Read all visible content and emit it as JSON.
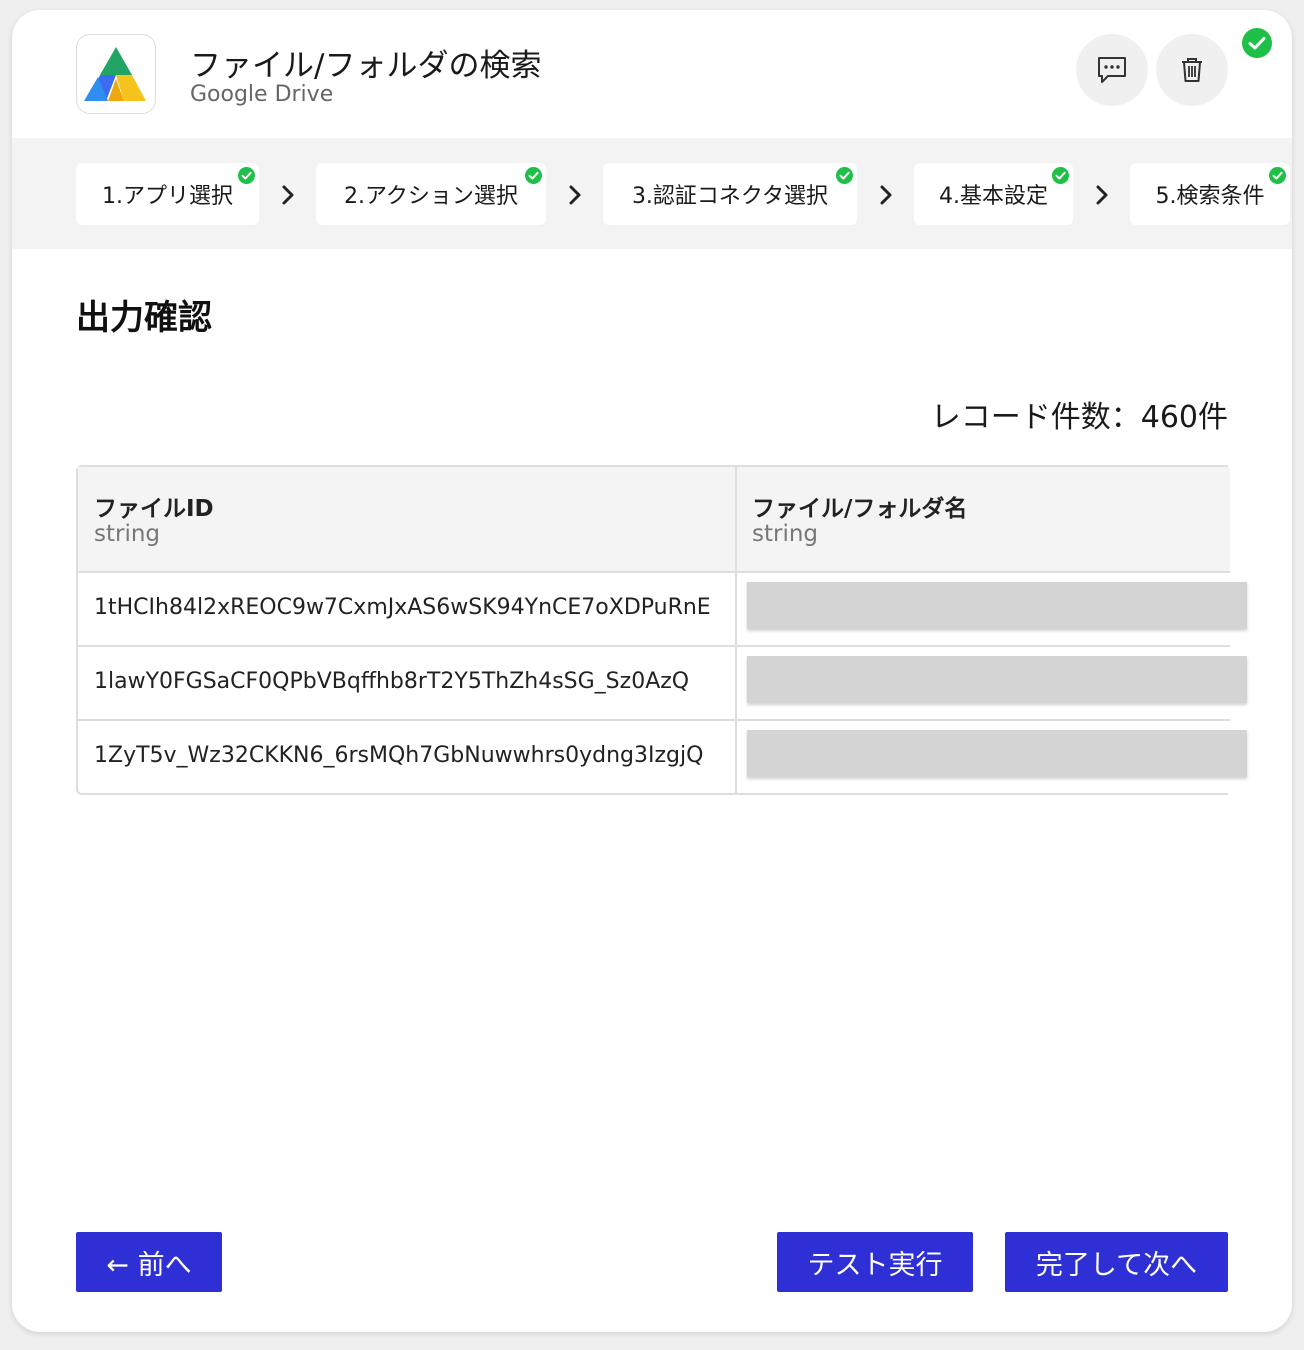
{
  "header": {
    "title": "ファイル/フォルダの検索",
    "subtitle": "Google Drive",
    "app_icon": "google-drive-logo",
    "comment_icon": "comment-icon",
    "delete_icon": "trash-icon",
    "status_icon": "check-circle-icon"
  },
  "steps": [
    {
      "label": "1.アプリ選択",
      "done": true
    },
    {
      "label": "2.アクション選択",
      "done": true
    },
    {
      "label": "3.認証コネクタ選択",
      "done": true
    },
    {
      "label": "4.基本設定",
      "done": true
    },
    {
      "label": "5.検索条件",
      "done": true
    }
  ],
  "section": {
    "title": "出力確認",
    "record_count": "レコード件数：460件"
  },
  "table": {
    "columns": [
      {
        "name": "ファイルID",
        "type": "string"
      },
      {
        "name": "ファイル/フォルダ名",
        "type": "string"
      }
    ],
    "rows": [
      {
        "file_id": "1tHCIh84l2xREOC9w7CxmJxAS6wSK94YnCE7oXDPuRnE"
      },
      {
        "file_id": "1lawY0FGSaCF0QPbVBqffhb8rT2Y5ThZh4sSG_Sz0AzQ"
      },
      {
        "file_id": "1ZyT5v_Wz32CKKN6_6rsMQh7GbNuwwhrs0ydng3IzgjQ"
      }
    ]
  },
  "footer": {
    "prev_label": "← 前へ",
    "test_label": "テスト実行",
    "next_label": "完了して次へ"
  },
  "colors": {
    "primary": "#2f2fd6",
    "success": "#1ec047",
    "background": "#efefef"
  }
}
